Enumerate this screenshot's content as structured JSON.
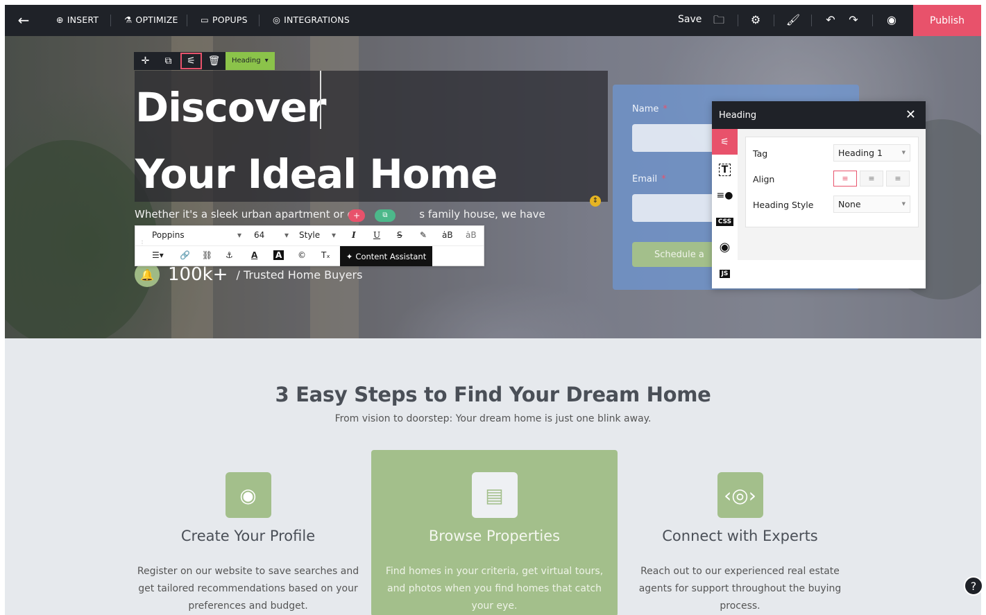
{
  "topbar": {
    "back_icon": "arrow-left-icon",
    "menu": [
      {
        "label": "INSERT",
        "icon": "plus-circle-icon"
      },
      {
        "label": "OPTIMIZE",
        "icon": "flask-icon"
      },
      {
        "label": "POPUPS",
        "icon": "popup-icon"
      },
      {
        "label": "INTEGRATIONS",
        "icon": "integrations-icon"
      }
    ],
    "save_label": "Save",
    "right_icons": [
      "folder-icon",
      "settings-icon",
      "paint-roller-icon",
      "undo-icon",
      "redo-icon",
      "eye-icon"
    ],
    "publish_label": "Publish",
    "publish_color": "#e8526b"
  },
  "hero": {
    "heading_line1": "Discover",
    "heading_line2": "Your Ideal Home",
    "element_tag": "Heading",
    "subtext": "Whether it's a sleek urban apartment or c",
    "subtext_tail": "s family house, we have",
    "stat_number": "100k+",
    "stat_label": "/ Trusted Home Buyers"
  },
  "rte": {
    "font": "Poppins",
    "size": "64",
    "style": "Style",
    "content_assistant": "Content Assistant"
  },
  "form": {
    "name_label": "Name",
    "email_label": "Email",
    "required_mark": "*",
    "button_label": "Schedule a"
  },
  "panel": {
    "title": "Heading",
    "tag_label": "Tag",
    "tag_value": "Heading 1",
    "align_label": "Align",
    "heading_style_label": "Heading Style",
    "heading_style_value": "None",
    "side_badges": {
      "css": "CSS",
      "js": "JS"
    }
  },
  "steps": {
    "title": "3 Easy Steps to Find Your Dream Home",
    "subtitle": "From vision to doorstep: Your dream home is just one blink away.",
    "cards": [
      {
        "title": "Create Your Profile",
        "desc": "Register on our website to save searches and get tailored recommendations based on your preferences and budget.",
        "icon": "user-circle-icon"
      },
      {
        "title": "Browse Properties",
        "desc": "Find homes in your criteria, get virtual tours, and photos when you find homes that catch your eye.",
        "icon": "browser-window-icon"
      },
      {
        "title": "Connect with Experts",
        "desc": "Reach out to our experienced real estate agents for support throughout the buying process.",
        "icon": "network-icon"
      }
    ]
  },
  "accent_green": "#a3bf8b"
}
